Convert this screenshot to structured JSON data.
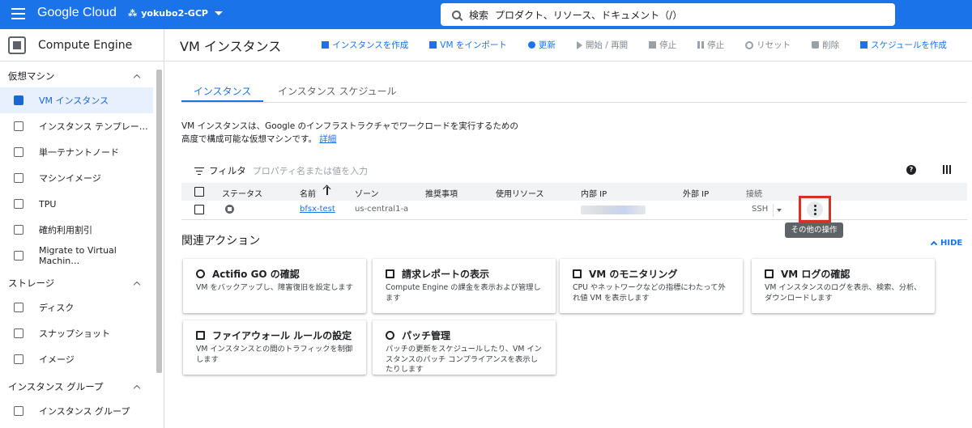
{
  "topbar": {
    "logo": "Google Cloud",
    "project": "yokubo2-GCP",
    "search_label": "検索",
    "search_text": "プロダクト、リソース、ドキュメント（/）"
  },
  "sidebar": {
    "title": "Compute Engine",
    "sections": [
      {
        "label": "仮想マシン",
        "items": [
          {
            "label": "VM インスタンス",
            "icon": "vm-instance-icon",
            "active": true
          },
          {
            "label": "インスタンス テンプレー…",
            "icon": "template-icon"
          },
          {
            "label": "単一テナントノード",
            "icon": "sole-tenant-icon"
          },
          {
            "label": "マシンイメージ",
            "icon": "machine-image-icon"
          },
          {
            "label": "TPU",
            "icon": "tpu-icon"
          },
          {
            "label": "確約利用割引",
            "icon": "discount-icon"
          },
          {
            "label": "Migrate to Virtual Machin…",
            "icon": "migrate-icon"
          }
        ]
      },
      {
        "label": "ストレージ",
        "items": [
          {
            "label": "ディスク",
            "icon": "disk-icon"
          },
          {
            "label": "スナップショット",
            "icon": "snapshot-icon"
          },
          {
            "label": "イメージ",
            "icon": "image-icon"
          }
        ]
      },
      {
        "label": "インスタンス グループ",
        "items": [
          {
            "label": "インスタンス グループ",
            "icon": "instance-group-icon"
          }
        ]
      }
    ]
  },
  "actionbar": {
    "page_title": "VM インスタンス",
    "create": "インスタンスを作成",
    "import": "VM をインポート",
    "refresh": "更新",
    "start": "開始 / 再開",
    "stop": "停止",
    "suspend": "停止",
    "reset": "リセット",
    "delete": "削除",
    "schedule": "スケジュールを作成"
  },
  "tabs": {
    "instances": "インスタンス",
    "schedules": "インスタンス スケジュール"
  },
  "description": {
    "line1": "VM インスタンスは、Google のインフラストラクチャでワークロードを実行するための",
    "line2": "高度で構成可能な仮想マシンです。",
    "link": "詳細"
  },
  "filter": {
    "label": "フィルタ",
    "placeholder": "プロパティ名または値を入力"
  },
  "table": {
    "headers": {
      "status": "ステータス",
      "name": "名前",
      "zone": "ゾーン",
      "recommendation": "推奨事項",
      "in_use_by": "使用リソース",
      "internal_ip": "内部 IP",
      "external_ip": "外部 IP",
      "connect": "接続"
    },
    "rows": [
      {
        "status": "stopped",
        "name": "bfsx-test",
        "zone": "us-central1-a",
        "connect": "SSH"
      }
    ]
  },
  "tooltip": "その他の操作",
  "related": {
    "title": "関連アクション",
    "hide": "HIDE",
    "cards": [
      {
        "title": "Actifio GO の確認",
        "desc": "VM をバックアップし、障害復旧を設定します",
        "icon": "actifio-icon"
      },
      {
        "title": "請求レポートの表示",
        "desc": "Compute Engine の課金を表示および管理します",
        "icon": "billing-icon"
      },
      {
        "title": "VM のモニタリング",
        "desc": "CPU やネットワークなどの指標にわたって外れ値 VM を表示します",
        "icon": "monitoring-icon"
      },
      {
        "title": "VM ログの確認",
        "desc": "VM インスタンスのログを表示、検索、分析、ダウンロードします",
        "icon": "logs-icon"
      },
      {
        "title": "ファイアウォール ルールの設定",
        "desc": "VM インスタンスとの間のトラフィックを制御します",
        "icon": "firewall-icon"
      },
      {
        "title": "パッチ管理",
        "desc": "パッチの更新をスケジュールしたり、VM インスタンスのパッチ コンプライアンスを表示したりします",
        "icon": "patch-icon"
      }
    ]
  }
}
